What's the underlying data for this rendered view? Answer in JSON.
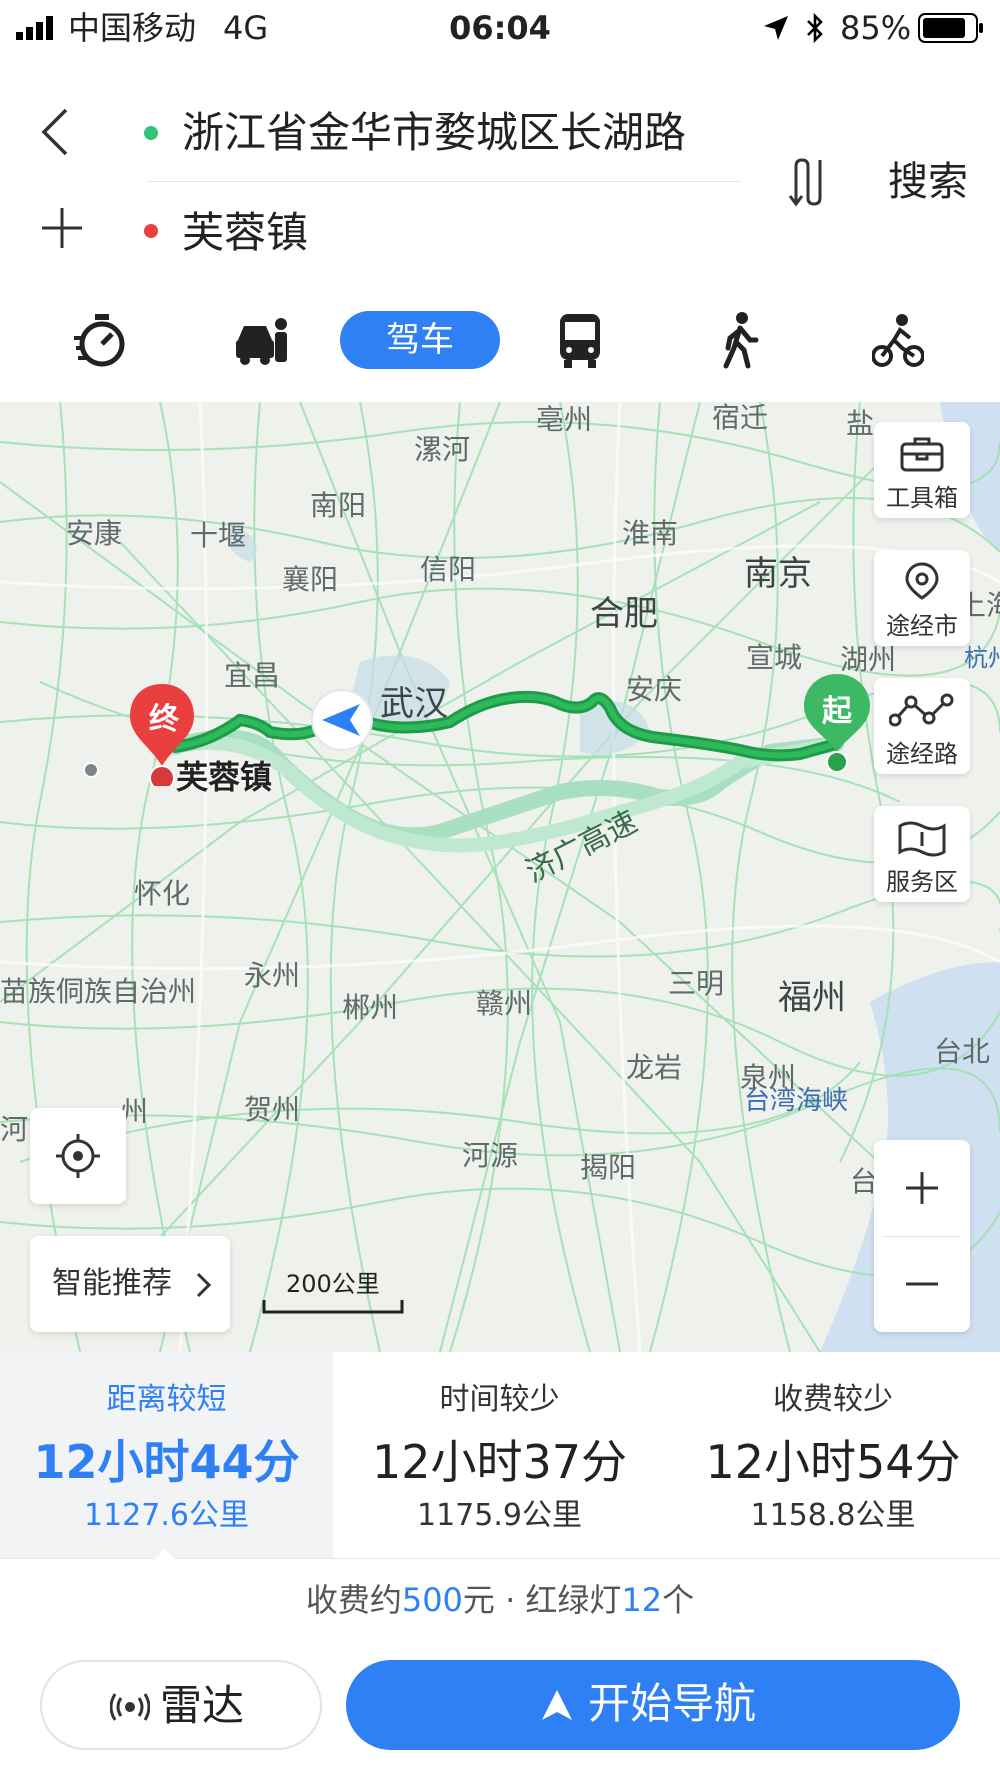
{
  "status_bar": {
    "carrier": "中国移动",
    "network": "4G",
    "time": "06:04",
    "battery": "85%"
  },
  "header": {
    "origin": "浙江省金华市婺城区长湖路",
    "destination": "芙蓉镇",
    "search_label": "搜索"
  },
  "modes": {
    "drive_label": "驾车",
    "icons": [
      "stopwatch-icon",
      "taxi-icon",
      "car-icon",
      "bus-icon",
      "walk-icon",
      "bike-icon"
    ]
  },
  "map": {
    "cities": [
      {
        "name": "亳州"
      },
      {
        "name": "宿迁"
      },
      {
        "name": "漯河"
      },
      {
        "name": "南阳"
      },
      {
        "name": "安康"
      },
      {
        "name": "十堰"
      },
      {
        "name": "淮南"
      },
      {
        "name": "南京"
      },
      {
        "name": "信阳"
      },
      {
        "name": "襄阳"
      },
      {
        "name": "合肥"
      },
      {
        "name": "宜昌"
      },
      {
        "name": "宣城"
      },
      {
        "name": "湖州"
      },
      {
        "name": "安庆"
      },
      {
        "name": "武汉"
      },
      {
        "name": "怀化"
      },
      {
        "name": "永州"
      },
      {
        "name": "苗族侗族自治州"
      },
      {
        "name": "郴州"
      },
      {
        "name": "赣州"
      },
      {
        "name": "三明"
      },
      {
        "name": "福州"
      },
      {
        "name": "龙岩"
      },
      {
        "name": "泉州"
      },
      {
        "name": "贺州"
      },
      {
        "name": "河源"
      },
      {
        "name": "揭阳"
      },
      {
        "name": "台湾海峡"
      },
      {
        "name": "盐"
      },
      {
        "name": "上海"
      },
      {
        "name": "杭州"
      },
      {
        "name": "台北"
      },
      {
        "name": "河"
      },
      {
        "name": "州"
      },
      {
        "name": "台"
      }
    ],
    "highway_label": "济广高速",
    "end_pin": "终",
    "start_pin": "起",
    "end_label": "芙蓉镇",
    "side_buttons": {
      "toolbox": "工具箱",
      "via_city": "途经市",
      "via_road": "途经路",
      "service": "服务区"
    },
    "smart_recommend": "智能推荐",
    "scale": "200公里"
  },
  "routes": [
    {
      "label": "距离较短",
      "duration": "12小时44分",
      "distance": "1127.6公里",
      "selected": true
    },
    {
      "label": "时间较少",
      "duration": "12小时37分",
      "distance": "1175.9公里",
      "selected": false
    },
    {
      "label": "收费较少",
      "duration": "12小时54分",
      "distance": "1158.8公里",
      "selected": false
    }
  ],
  "fee": {
    "prefix": "收费约",
    "amount": "500",
    "mid": "元 · 红绿灯",
    "lights": "12",
    "suffix": "个"
  },
  "buttons": {
    "radar": "雷达",
    "navigate": "开始导航"
  },
  "colors": {
    "accent": "#2f80f5",
    "route_main": "#1e9b47",
    "route_alt": "#9fdcb8",
    "start_pin": "#3db864",
    "end_pin": "#ea3f3f"
  }
}
